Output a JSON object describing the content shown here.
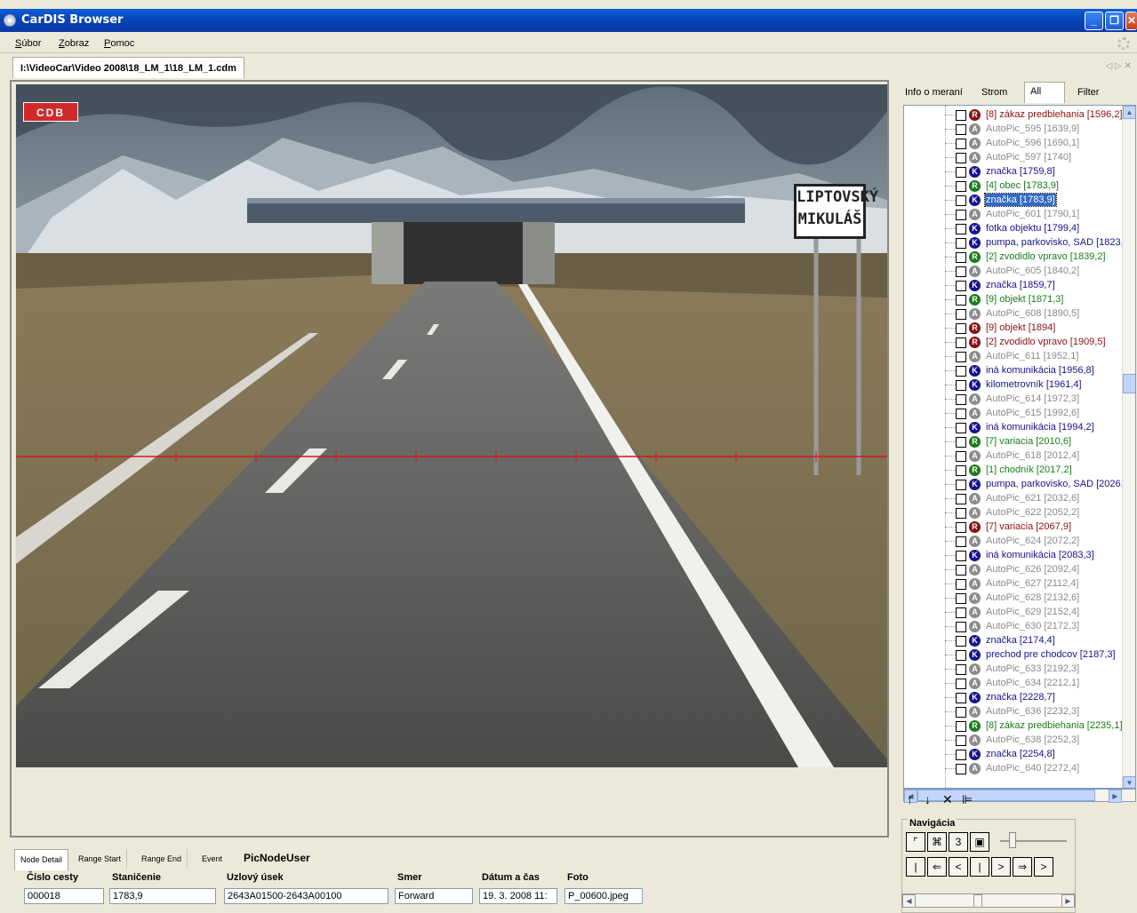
{
  "window": {
    "title": "CarDIS Browser",
    "minimize": "_",
    "maximize": "❐",
    "close": "✕"
  },
  "menu": [
    {
      "label": "Súbor",
      "key": "S",
      "rest": "úbor"
    },
    {
      "label": "Zobraz",
      "key": "Z",
      "rest": "obraz"
    },
    {
      "label": "Pomoc",
      "key": "P",
      "rest": "omoc"
    }
  ],
  "path_tab": "I:\\VideoCar\\Video 2008\\18_LM_1\\18_LM_1.cdm",
  "path_arrows": "◁ ▷ ✕",
  "photo": {
    "logo_text": "CDB",
    "sign_line1": "LIPTOVSKÝ",
    "sign_line2": "MIKULÁŠ"
  },
  "bottom": {
    "tabs": [
      "Node Detail",
      "Range Start",
      "Range End",
      "Event"
    ],
    "section_title": "PicNodeUser",
    "fields": [
      {
        "label": "Číslo cesty",
        "value": "000018"
      },
      {
        "label": "Staničenie",
        "value": "1783,9"
      },
      {
        "label": "Uzlový úsek",
        "value": "2643A01500-2643A00100"
      },
      {
        "label": "Smer",
        "value": "Forward"
      },
      {
        "label": "Dátum a čas",
        "value": "19. 3. 2008 11:"
      },
      {
        "label": "Foto",
        "value": "P_00600.jpeg"
      }
    ]
  },
  "right_tabs": [
    "Info o meraní",
    "Strom",
    "All",
    "Filter"
  ],
  "colors": {
    "R": "#8b1010",
    "A": "#8c8c8c",
    "K": "#14148c",
    "G": "#1b7a1b",
    "selection": "#316ac5"
  },
  "tree_items": [
    {
      "t": "R",
      "label": "[8] zákaz predbiehania [1596,2]"
    },
    {
      "t": "A",
      "label": "AutoPic_595 [1639,9]"
    },
    {
      "t": "A",
      "label": "AutoPic_596 [1690,1]"
    },
    {
      "t": "A",
      "label": "AutoPic_597 [1740]"
    },
    {
      "t": "K",
      "label": "značka [1759,8]"
    },
    {
      "t": "G",
      "label": "[4] obec [1783,9]"
    },
    {
      "t": "K",
      "label": "značka [1783,9]",
      "selected": true
    },
    {
      "t": "A",
      "label": "AutoPic_601 [1790,1]"
    },
    {
      "t": "K",
      "label": "fotka objektu [1799,4]"
    },
    {
      "t": "K",
      "label": "pumpa, parkovisko, SAD [1823,"
    },
    {
      "t": "G",
      "label": "[2] zvodidlo vpravo [1839,2]"
    },
    {
      "t": "A",
      "label": "AutoPic_605 [1840,2]"
    },
    {
      "t": "K",
      "label": "značka [1859,7]"
    },
    {
      "t": "G",
      "label": "[9] objekt [1871,3]"
    },
    {
      "t": "A",
      "label": "AutoPic_608 [1890,5]"
    },
    {
      "t": "R",
      "label": "[9] objekt [1894]"
    },
    {
      "t": "R",
      "label": "[2] zvodidlo vpravo [1909,5]"
    },
    {
      "t": "A",
      "label": "AutoPic_611 [1952,1]"
    },
    {
      "t": "K",
      "label": "iná komunikácia [1956,8]"
    },
    {
      "t": "K",
      "label": "kilometrovník [1961,4]"
    },
    {
      "t": "A",
      "label": "AutoPic_614 [1972,3]"
    },
    {
      "t": "A",
      "label": "AutoPic_615 [1992,6]"
    },
    {
      "t": "K",
      "label": "iná komunikácia [1994,2]"
    },
    {
      "t": "G",
      "label": "[7] variacia [2010,6]"
    },
    {
      "t": "A",
      "label": "AutoPic_618 [2012,4]"
    },
    {
      "t": "G",
      "label": "[1] chodník [2017,2]"
    },
    {
      "t": "K",
      "label": "pumpa, parkovisko, SAD [2026,"
    },
    {
      "t": "A",
      "label": "AutoPic_621 [2032,6]"
    },
    {
      "t": "A",
      "label": "AutoPic_622 [2052,2]"
    },
    {
      "t": "R",
      "label": "[7] variacia [2067,9]"
    },
    {
      "t": "A",
      "label": "AutoPic_624 [2072,2]"
    },
    {
      "t": "K",
      "label": "iná komunikácia [2083,3]"
    },
    {
      "t": "A",
      "label": "AutoPic_626 [2092,4]"
    },
    {
      "t": "A",
      "label": "AutoPic_627 [2112,4]"
    },
    {
      "t": "A",
      "label": "AutoPic_628 [2132,6]"
    },
    {
      "t": "A",
      "label": "AutoPic_629 [2152,4]"
    },
    {
      "t": "A",
      "label": "AutoPic_630 [2172,3]"
    },
    {
      "t": "K",
      "label": "značka [2174,4]"
    },
    {
      "t": "K",
      "label": "prechod pre chodcov [2187,3]"
    },
    {
      "t": "A",
      "label": "AutoPic_633 [2192,3]"
    },
    {
      "t": "A",
      "label": "AutoPic_634 [2212,1]"
    },
    {
      "t": "K",
      "label": "značka [2228,7]"
    },
    {
      "t": "A",
      "label": "AutoPic_636 [2232,3]"
    },
    {
      "t": "G",
      "label": "[8] zákaz predbiehania [2235,1]"
    },
    {
      "t": "A",
      "label": "AutoPic_638 [2252,3]"
    },
    {
      "t": "K",
      "label": "značka [2254,8]"
    },
    {
      "t": "A",
      "label": "AutoPic_640 [2272,4]"
    }
  ],
  "tree_tools": [
    "↑",
    "↓",
    "✕",
    "⊫"
  ],
  "nav": {
    "title": "Navigácia",
    "row1": [
      "⌜",
      "⌘",
      "3",
      "▣"
    ],
    "row2": [
      "|",
      "⇐",
      "<",
      "|",
      ">",
      "⇒",
      ">"
    ]
  }
}
